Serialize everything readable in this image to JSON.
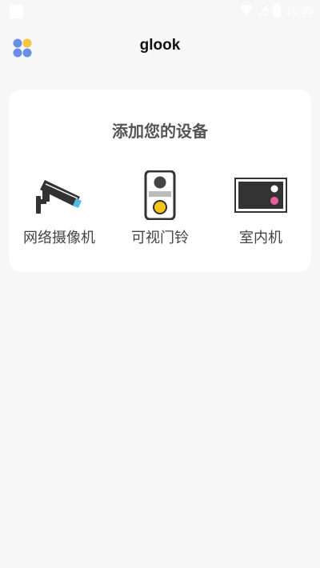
{
  "status_bar": {
    "time": "10:39"
  },
  "header": {
    "title": "glook"
  },
  "card": {
    "title": "添加您的设备",
    "devices": [
      {
        "label": "网络摄像机",
        "icon": "security-camera-icon"
      },
      {
        "label": "可视门铃",
        "icon": "video-doorbell-icon"
      },
      {
        "label": "室内机",
        "icon": "indoor-monitor-icon"
      }
    ]
  },
  "colors": {
    "background": "#f7f7f7",
    "card": "#ffffff",
    "icon_dark": "#333333",
    "accent_blue": "#58b9e8",
    "accent_yellow": "#f5c519",
    "accent_pink": "#e8609a",
    "app_icon_blue": "#6b8de6",
    "app_icon_yellow": "#f5c544"
  }
}
